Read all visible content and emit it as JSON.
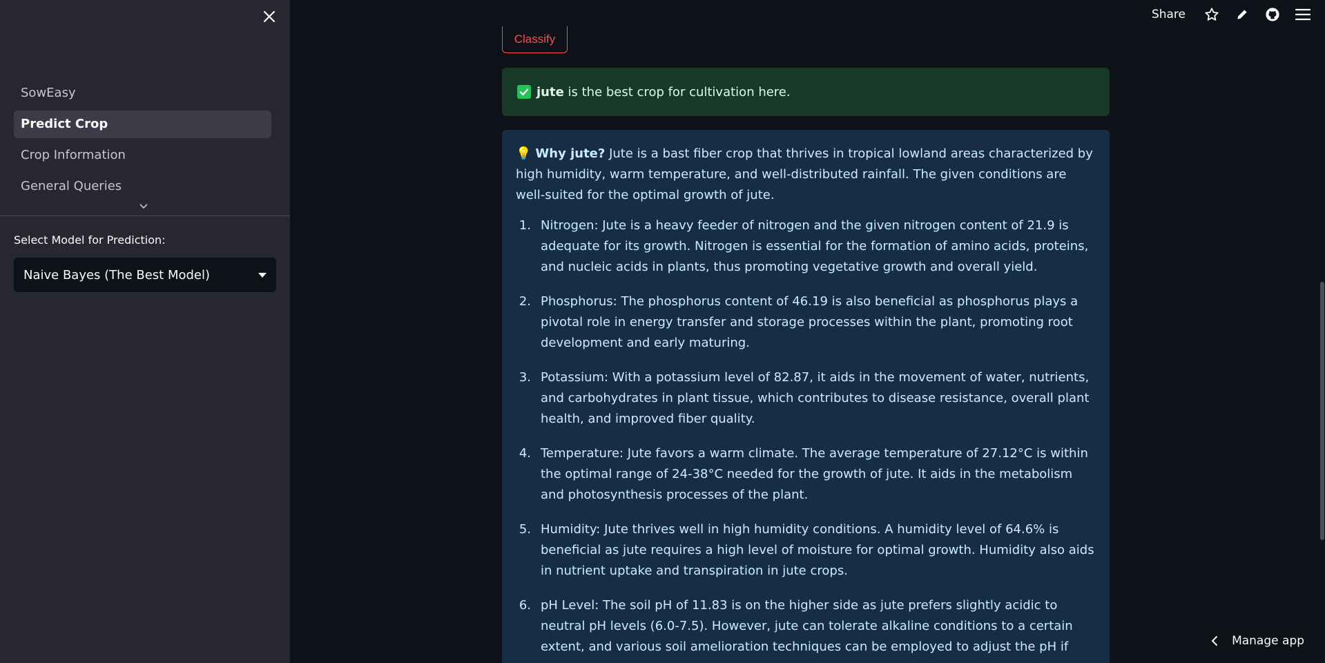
{
  "sidebar": {
    "nav_items": [
      {
        "label": "SowEasy",
        "active": false
      },
      {
        "label": "Predict Crop",
        "active": true
      },
      {
        "label": "Crop Information",
        "active": false
      },
      {
        "label": "General Queries",
        "active": false
      }
    ],
    "model_label": "Select Model for Prediction:",
    "model_value": "Naive Bayes (The Best Model)"
  },
  "topbar": {
    "share_label": "Share",
    "icons": [
      "star-icon",
      "pencil-icon",
      "github-icon",
      "hamburger-menu-icon"
    ]
  },
  "main": {
    "classify_label": "Classify",
    "success": {
      "crop": "jute",
      "message": " is the best crop for cultivation here."
    },
    "explanation": {
      "heading": "Why jute?",
      "intro": " Jute is a bast fiber crop that thrives in tropical lowland areas characterized by high humidity, warm temperature, and well-distributed rainfall. The given conditions are well-suited for the optimal growth of jute.",
      "items": [
        {
          "num": "1.",
          "text": "Nitrogen: Jute is a heavy feeder of nitrogen and the given nitrogen content of 21.9 is adequate for its growth. Nitrogen is essential for the formation of amino acids, proteins, and nucleic acids in plants, thus promoting vegetative growth and overall yield."
        },
        {
          "num": "2.",
          "text": "Phosphorus: The phosphorus content of 46.19 is also beneficial as phosphorus plays a pivotal role in energy transfer and storage processes within the plant, promoting root development and early maturing."
        },
        {
          "num": "3.",
          "text": "Potassium: With a potassium level of 82.87, it aids in the movement of water, nutrients, and carbohydrates in plant tissue, which contributes to disease resistance, overall plant health, and improved fiber quality."
        },
        {
          "num": "4.",
          "text": "Temperature: Jute favors a warm climate. The average temperature of 27.12°C is within the optimal range of 24-38°C needed for the growth of jute. It aids in the metabolism and photosynthesis processes of the plant."
        },
        {
          "num": "5.",
          "text": "Humidity: Jute thrives well in high humidity conditions. A humidity level of 64.6% is beneficial as jute requires a high level of moisture for optimal growth. Humidity also aids in nutrient uptake and transpiration in jute crops."
        },
        {
          "num": "6.",
          "text": "pH Level: The soil pH of 11.83 is on the higher side as jute prefers slightly acidic to neutral pH levels (6.0-7.5). However, jute can tolerate alkaline conditions to a certain extent, and various soil amelioration techniques can be employed to adjust the pH if necessary."
        }
      ]
    }
  },
  "footer": {
    "manage_label": "Manage app"
  },
  "colors": {
    "sidebar_bg": "#262730",
    "main_bg": "#0e1117",
    "accent": "#ff4b4b",
    "success_bg": "#173928",
    "info_bg": "#172d43"
  }
}
